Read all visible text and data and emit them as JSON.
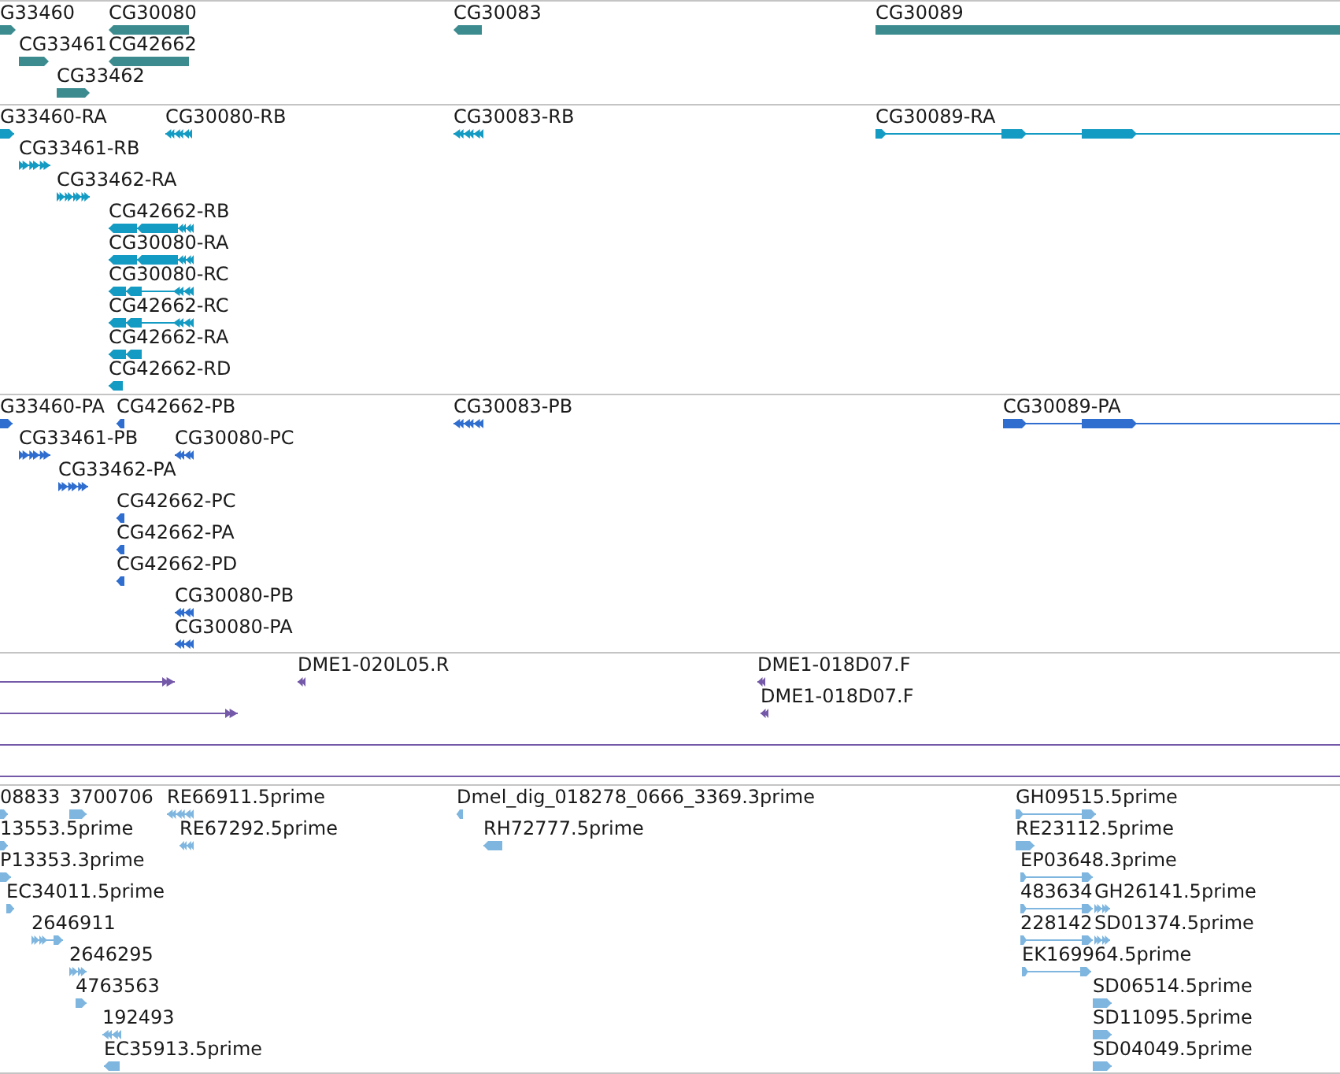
{
  "tracks": [
    {
      "kind": "gene",
      "color": "#3b8b8f",
      "rows": [
        {
          "features": [
            {
              "label": "G33460",
              "reverse": false
            },
            {
              "label": "CG30080",
              "reverse": true
            },
            {
              "label": "CG30083",
              "reverse": true
            },
            {
              "label": "CG30089",
              "reverse": false
            }
          ]
        },
        {
          "features": [
            {
              "label": "CG33461",
              "reverse": false
            },
            {
              "label": "CG42662",
              "reverse": true
            }
          ]
        },
        {
          "features": [
            {
              "label": "CG33462",
              "reverse": false
            }
          ]
        }
      ]
    },
    {
      "kind": "transcript",
      "color": "#149bc3",
      "rows": [
        {
          "features": [
            {
              "label": "G33460-RA",
              "reverse": false
            },
            {
              "label": "CG30080-RB",
              "reverse": true
            },
            {
              "label": "CG30083-RB",
              "reverse": true
            },
            {
              "label": "CG30089-RA",
              "reverse": false
            }
          ]
        },
        {
          "features": [
            {
              "label": "CG33461-RB",
              "reverse": false
            }
          ]
        },
        {
          "features": [
            {
              "label": "CG33462-RA",
              "reverse": false
            }
          ]
        },
        {
          "features": [
            {
              "label": "CG42662-RB",
              "reverse": true
            }
          ]
        },
        {
          "features": [
            {
              "label": "CG30080-RA",
              "reverse": true
            }
          ]
        },
        {
          "features": [
            {
              "label": "CG30080-RC",
              "reverse": true
            }
          ]
        },
        {
          "features": [
            {
              "label": "CG42662-RC",
              "reverse": true
            }
          ]
        },
        {
          "features": [
            {
              "label": "CG42662-RA",
              "reverse": true
            }
          ]
        },
        {
          "features": [
            {
              "label": "CG42662-RD",
              "reverse": true
            }
          ]
        }
      ]
    },
    {
      "kind": "protein",
      "color": "#2f6ecf",
      "rows": [
        {
          "features": [
            {
              "label": "G33460-PA",
              "reverse": false
            },
            {
              "label": "CG42662-PB",
              "reverse": true
            },
            {
              "label": "CG30083-PB",
              "reverse": true
            },
            {
              "label": "CG30089-PA",
              "reverse": false
            }
          ]
        },
        {
          "features": [
            {
              "label": "CG33461-PB",
              "reverse": false
            },
            {
              "label": "CG30080-PC",
              "reverse": true
            }
          ]
        },
        {
          "features": [
            {
              "label": "CG33462-PA",
              "reverse": false
            }
          ]
        },
        {
          "features": [
            {
              "label": "CG42662-PC",
              "reverse": true
            }
          ]
        },
        {
          "features": [
            {
              "label": "CG42662-PA",
              "reverse": true
            }
          ]
        },
        {
          "features": [
            {
              "label": "CG42662-PD",
              "reverse": true
            }
          ]
        },
        {
          "features": [
            {
              "label": "CG30080-PB",
              "reverse": true
            }
          ]
        },
        {
          "features": [
            {
              "label": "CG30080-PA",
              "reverse": true
            }
          ]
        }
      ]
    },
    {
      "kind": "clone",
      "color": "#7559a9",
      "rows": [
        {
          "features": [
            {
              "kind": "arrow",
              "reverse": false
            },
            {
              "kind": "arrow",
              "label": "DME1-020L05.R",
              "reverse": true
            },
            {
              "kind": "arrow",
              "label": "DME1-018D07.F",
              "reverse": true
            }
          ]
        },
        {
          "features": [
            {
              "kind": "arrow",
              "reverse": false
            },
            {
              "kind": "arrow",
              "label": "DME1-018D07.F",
              "reverse": true
            }
          ]
        },
        {
          "features": [
            {
              "kind": "span"
            }
          ]
        },
        {
          "features": [
            {
              "kind": "span"
            }
          ]
        }
      ]
    },
    {
      "kind": "est",
      "color": "#7fb6df",
      "rows": [
        {
          "features": [
            {
              "label": "08833",
              "reverse": false
            },
            {
              "label": "3700706",
              "reverse": false
            },
            {
              "label": "RE66911.5prime",
              "reverse": true
            },
            {
              "label": "Dmel_dig_018278_0666_3369.3prime",
              "reverse": true
            },
            {
              "label": "GH09515.5prime",
              "reverse": false
            }
          ]
        },
        {
          "features": [
            {
              "label": "13553.5prime",
              "reverse": false
            },
            {
              "label": "RE67292.5prime",
              "reverse": true
            },
            {
              "label": "RH72777.5prime",
              "reverse": true
            },
            {
              "label": "RE23112.5prime",
              "reverse": false
            }
          ]
        },
        {
          "features": [
            {
              "label": "P13353.3prime",
              "reverse": false
            },
            {
              "label": "EP03648.3prime",
              "reverse": false
            }
          ]
        },
        {
          "features": [
            {
              "label": "EC34011.5prime",
              "reverse": false
            },
            {
              "label": "483634",
              "reverse": false
            },
            {
              "label": "GH26141.5prime",
              "reverse": false
            }
          ]
        },
        {
          "features": [
            {
              "label": "2646911",
              "reverse": false
            },
            {
              "label": "228142",
              "reverse": false
            },
            {
              "label": "SD01374.5prime",
              "reverse": false
            }
          ]
        },
        {
          "features": [
            {
              "label": "2646295",
              "reverse": false
            },
            {
              "label": "EK169964.5prime",
              "reverse": false
            }
          ]
        },
        {
          "features": [
            {
              "label": "4763563",
              "reverse": false
            },
            {
              "label": "SD06514.5prime",
              "reverse": false
            }
          ]
        },
        {
          "features": [
            {
              "label": "192493",
              "reverse": true
            },
            {
              "label": "SD11095.5prime",
              "reverse": false
            }
          ]
        },
        {
          "features": [
            {
              "label": "EC35913.5prime",
              "reverse": true
            },
            {
              "label": "SD04049.5prime",
              "reverse": false
            }
          ]
        }
      ]
    }
  ]
}
